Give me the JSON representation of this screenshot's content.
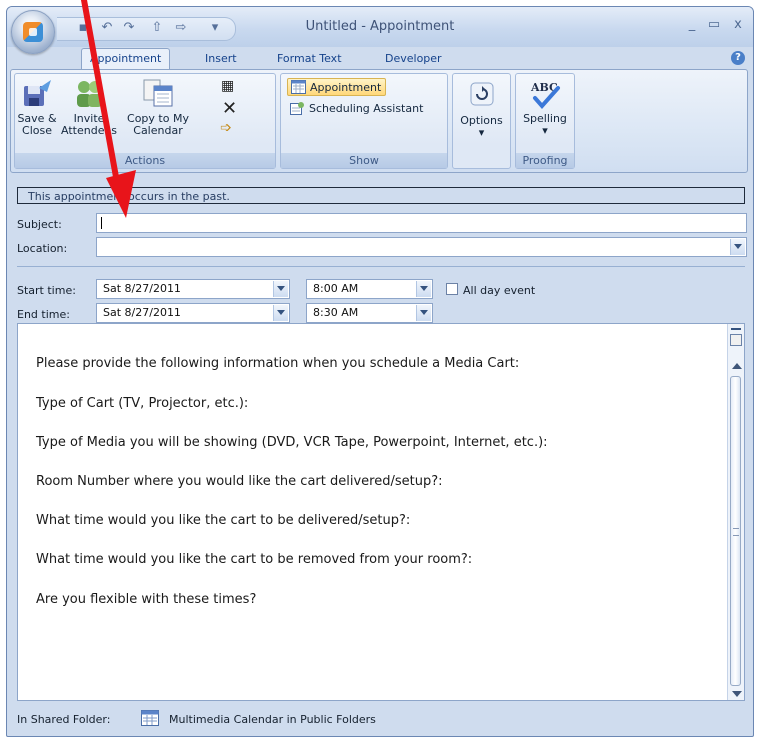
{
  "window": {
    "title": "Untitled - Appointment"
  },
  "tabs": [
    "Appointment",
    "Insert",
    "Format Text",
    "Developer"
  ],
  "ribbon": {
    "actions": {
      "label": "Actions",
      "save_close": [
        "Save &",
        "Close"
      ],
      "invite_attendees": [
        "Invite",
        "Attendees"
      ],
      "copy_calendar": [
        "Copy to My",
        "Calendar"
      ]
    },
    "show": {
      "label": "Show",
      "appointment": "Appointment",
      "scheduling": "Scheduling Assistant"
    },
    "options": {
      "label": "Options"
    },
    "proofing": {
      "label": "Proofing",
      "spelling": "Spelling",
      "abc": "ABC"
    }
  },
  "info_bar": "This appointment occurs in the past.",
  "form": {
    "subject_label": "Subject:",
    "subject_value": "",
    "location_label": "Location:",
    "location_value": "",
    "start_label": "Start time:",
    "start_date": "Sat 8/27/2011",
    "start_time": "8:00 AM",
    "end_label": "End time:",
    "end_date": "Sat 8/27/2011",
    "end_time": "8:30 AM",
    "all_day_label": "All day event",
    "all_day_checked": false
  },
  "body_lines": [
    "Please provide the following information when you schedule a Media Cart:",
    "Type of Cart (TV, Projector, etc.):",
    "Type of Media you will be showing (DVD, VCR Tape, Powerpoint, Internet, etc.):",
    "Room Number where you would like the cart delivered/setup?:",
    "What time would you like the cart to be delivered/setup?:",
    "What time would you like the cart to be removed from your room?:",
    "Are you flexible with these times?"
  ],
  "status": {
    "folder_label": "In Shared Folder:",
    "folder_name": "Multimedia Calendar in Public Folders"
  },
  "colors": {
    "arrow": "#e8141a",
    "accent": "#15428b"
  }
}
